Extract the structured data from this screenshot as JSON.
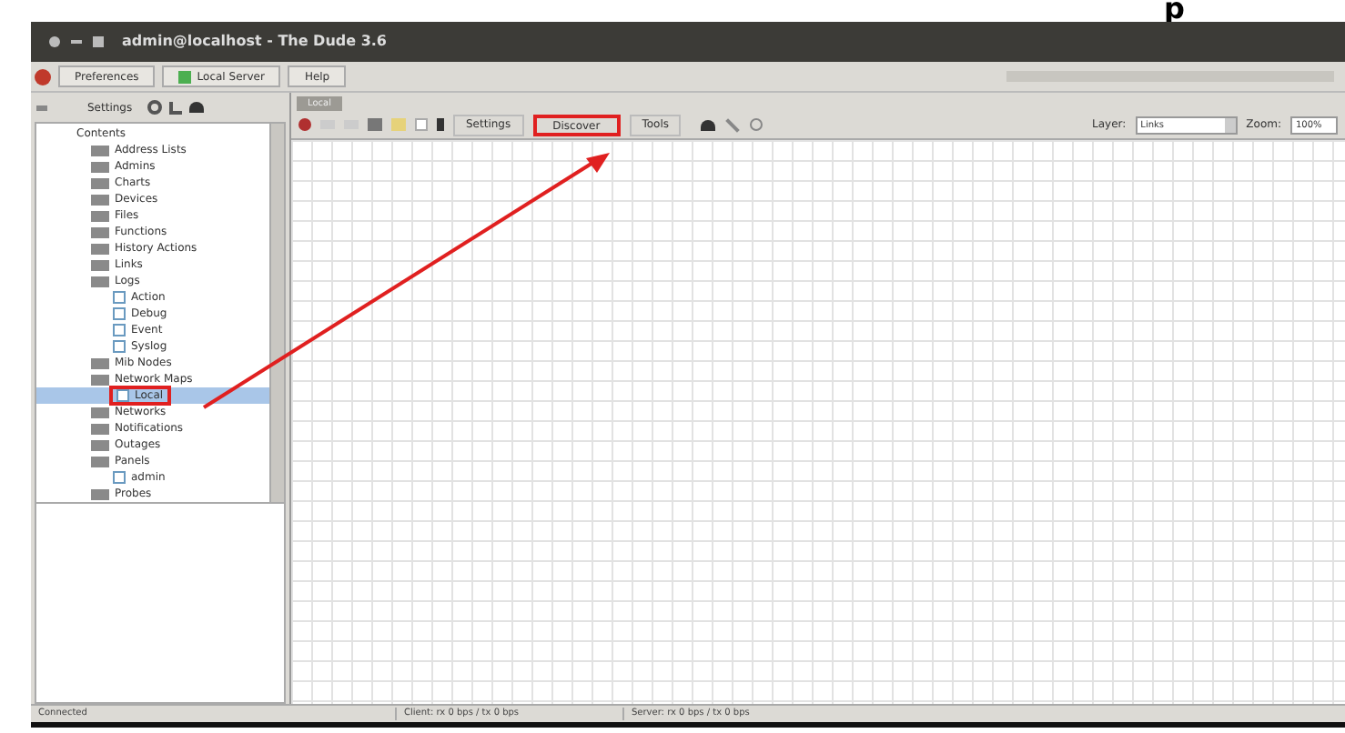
{
  "caption_fragment": "p",
  "window": {
    "title": "admin@localhost - The Dude 3.6"
  },
  "menu": [
    {
      "label": "Preferences"
    },
    {
      "label": "Local Server"
    },
    {
      "label": "Help"
    }
  ],
  "sidebar": {
    "settings_button": "Settings",
    "header": "Contents",
    "items": [
      {
        "label": "Address Lists",
        "selected": false,
        "callout": false
      },
      {
        "label": "Admins",
        "selected": false,
        "callout": false
      },
      {
        "label": "Charts",
        "selected": false,
        "callout": false
      },
      {
        "label": "Devices",
        "selected": false,
        "callout": false
      },
      {
        "label": "Files",
        "selected": false,
        "callout": false
      },
      {
        "label": "Functions",
        "selected": false,
        "callout": false
      },
      {
        "label": "History Actions",
        "selected": false,
        "callout": false
      },
      {
        "label": "Links",
        "selected": false,
        "callout": false
      },
      {
        "label": "Logs",
        "selected": false,
        "callout": false,
        "children": [
          {
            "label": "Action",
            "selected": false,
            "callout": false
          },
          {
            "label": "Debug",
            "selected": false,
            "callout": false
          },
          {
            "label": "Event",
            "selected": false,
            "callout": false
          },
          {
            "label": "Syslog",
            "selected": false,
            "callout": false
          }
        ]
      },
      {
        "label": "Mib Nodes",
        "selected": false,
        "callout": false
      },
      {
        "label": "Network Maps",
        "selected": false,
        "callout": false,
        "children": [
          {
            "label": "Local",
            "selected": true,
            "callout": true
          }
        ]
      },
      {
        "label": "Networks",
        "selected": false,
        "callout": false
      },
      {
        "label": "Notifications",
        "selected": false,
        "callout": false
      },
      {
        "label": "Outages",
        "selected": false,
        "callout": false
      },
      {
        "label": "Panels",
        "selected": false,
        "callout": false,
        "children": [
          {
            "label": "admin",
            "selected": false,
            "callout": false
          }
        ]
      },
      {
        "label": "Probes",
        "selected": false,
        "callout": false
      }
    ]
  },
  "map": {
    "tab": "Local",
    "buttons": [
      {
        "label": "Settings",
        "callout": false
      },
      {
        "label": "Discover",
        "callout": true
      },
      {
        "label": "Tools",
        "callout": false
      }
    ],
    "layer_label": "Layer:",
    "layer_value": "Links",
    "zoom_label": "Zoom:",
    "zoom_value": "100%"
  },
  "status_bar": [
    "Connected",
    "Client: rx 0 bps / tx 0 bps",
    "Server: rx 0 bps / tx 0 bps"
  ]
}
